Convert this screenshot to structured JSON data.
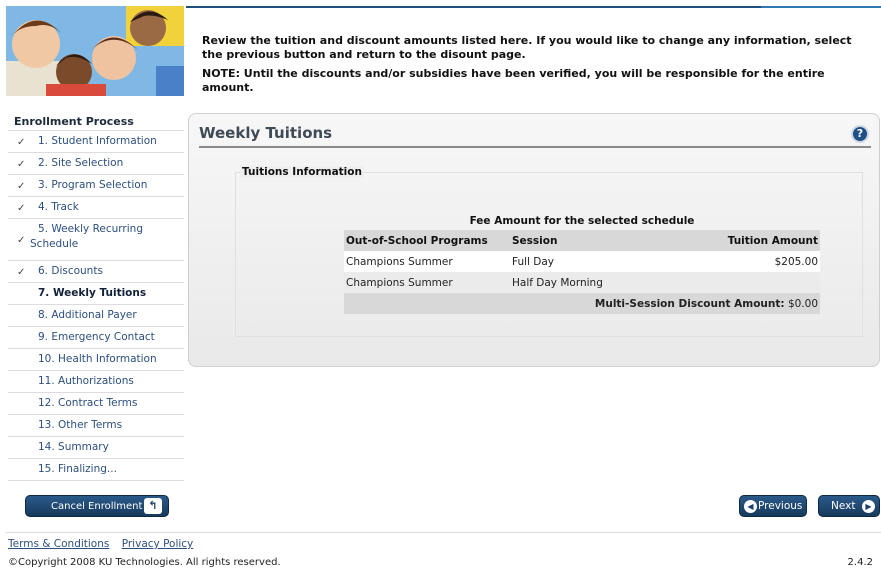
{
  "instructions": {
    "line1": "Review the tuition and discount amounts listed here. If you would like to change any information, select the previous button and return to the disount page.",
    "note": "NOTE: Until the discounts and/or subsidies have been verified, you will be responsible for the entire amount."
  },
  "sidebar": {
    "title": "Enrollment Process",
    "steps": [
      {
        "label": "1. Student Information",
        "check": "✓"
      },
      {
        "label": "2. Site Selection",
        "check": "✓"
      },
      {
        "label": "3. Program Selection",
        "check": "✓"
      },
      {
        "label": "4. Track",
        "check": "✓"
      },
      {
        "label": "5. Weekly Recurring",
        "label2": "Schedule",
        "check": "✓"
      },
      {
        "label": "6. Discounts",
        "check": "✓"
      },
      {
        "label": "7. Weekly Tuitions"
      },
      {
        "label": "8. Additional Payer"
      },
      {
        "label": "9. Emergency Contact"
      },
      {
        "label": "10. Health Information"
      },
      {
        "label": "11. Authorizations"
      },
      {
        "label": "12. Contract Terms"
      },
      {
        "label": "13. Other Terms"
      },
      {
        "label": "14. Summary"
      },
      {
        "label": "15. Finalizing..."
      }
    ],
    "cancel_label": "Cancel Enrollment"
  },
  "panel": {
    "title": "Weekly Tuitions",
    "help": "?",
    "section_legend": "Tuitions Information",
    "table_caption": "Fee Amount for the selected schedule",
    "columns": [
      "Out-of-School Programs",
      "Session",
      "Tuition Amount"
    ],
    "rows": [
      {
        "program": "Champions Summer",
        "session": "Full Day",
        "amount": "$205.00"
      },
      {
        "program": "Champions Summer",
        "session": "Half Day Morning",
        "amount": ""
      }
    ],
    "discount_label": "Multi-Session Discount Amount:",
    "discount_value": "$0.00"
  },
  "nav": {
    "previous_label": "Previous",
    "next_label": "Next"
  },
  "footer": {
    "terms": "Terms & Conditions",
    "privacy": "Privacy Policy",
    "copyright": "©Copyright 2008 KU Technologies. All rights reserved.",
    "version": "2.4.2"
  },
  "colors": {
    "accent": "#1d4f7a",
    "link": "#2c4f7f"
  }
}
